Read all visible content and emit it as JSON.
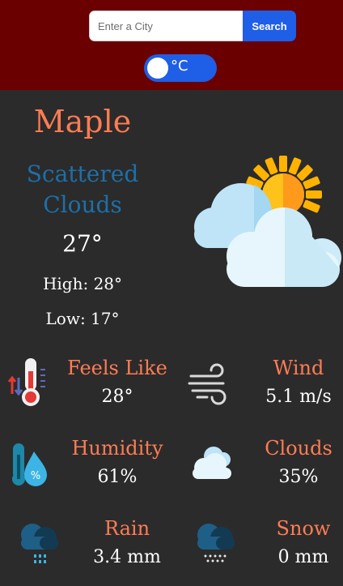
{
  "search": {
    "placeholder": "Enter a City",
    "button_label": "Search"
  },
  "unit_toggle": {
    "label": "°C"
  },
  "weather": {
    "city": "Maple",
    "condition_line1": "Scattered",
    "condition_line2": "Clouds",
    "temperature": "27°",
    "high": "High: 28°",
    "low": "Low: 17°",
    "icon": "sun-behind-clouds-icon"
  },
  "details": [
    {
      "title": "Feels Like",
      "value": "28°",
      "icon": "thermometer-icon"
    },
    {
      "title": "Wind",
      "value": "5.1 m/s",
      "icon": "wind-icon"
    },
    {
      "title": "Humidity",
      "value": "61%",
      "icon": "humidity-icon"
    },
    {
      "title": "Clouds",
      "value": "35%",
      "icon": "clouds-icon"
    },
    {
      "title": "Rain",
      "value": "3.4 mm",
      "icon": "rain-icon"
    },
    {
      "title": "Snow",
      "value": "0 mm",
      "icon": "snow-icon"
    }
  ],
  "colors": {
    "header_bg": "#6b0000",
    "body_bg": "#2b2b2b",
    "accent_orange": "#ff7c54",
    "condition_blue": "#1e6fa8",
    "button_blue": "#1f5ee6"
  }
}
